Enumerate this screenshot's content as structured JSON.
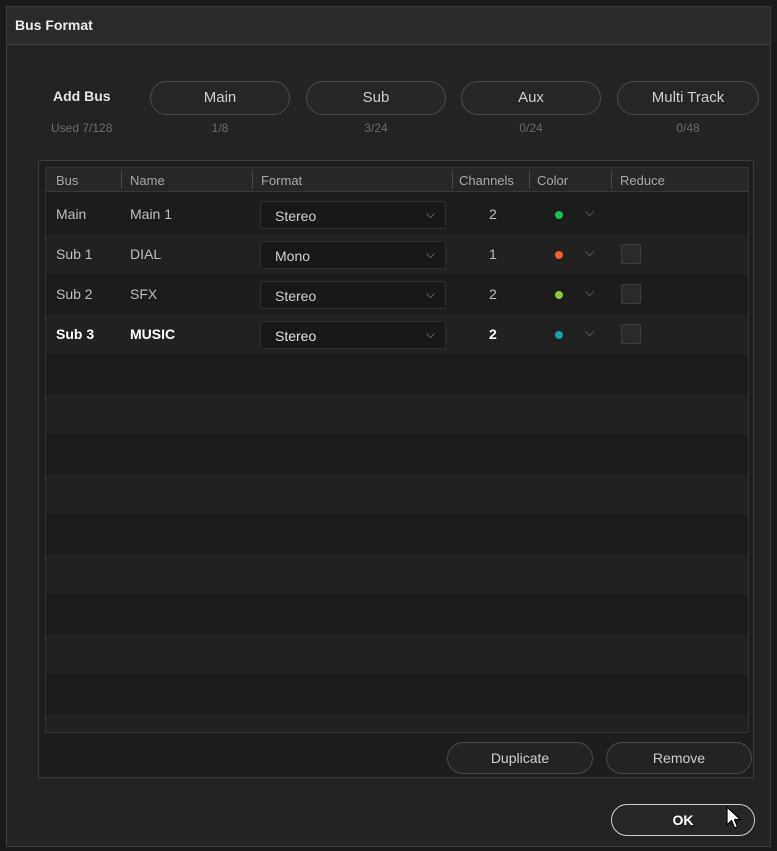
{
  "dialog": {
    "title": "Bus Format"
  },
  "add_bus": {
    "label": "Add Bus",
    "used": "Used 7/128",
    "buttons": [
      {
        "label": "Main",
        "count": "1/8"
      },
      {
        "label": "Sub",
        "count": "3/24"
      },
      {
        "label": "Aux",
        "count": "0/24"
      },
      {
        "label": "Multi Track",
        "count": "0/48"
      }
    ]
  },
  "table": {
    "headers": [
      "Bus",
      "Name",
      "Format",
      "Channels",
      "Color",
      "Reduce"
    ],
    "rows": [
      {
        "bus": "Main",
        "name": "Main 1",
        "format": "Stereo",
        "channels": "2",
        "color": "#1fbf5a",
        "reduce": null
      },
      {
        "bus": "Sub 1",
        "name": "DIAL",
        "format": "Mono",
        "channels": "1",
        "color": "#f0602a",
        "reduce": false
      },
      {
        "bus": "Sub 2",
        "name": "SFX",
        "format": "Stereo",
        "channels": "2",
        "color": "#8dc63f",
        "reduce": false
      },
      {
        "bus": "Sub 3",
        "name": "MUSIC",
        "format": "Stereo",
        "channels": "2",
        "color": "#13a4a8",
        "reduce": false
      }
    ]
  },
  "footer": {
    "duplicate": "Duplicate",
    "remove": "Remove"
  },
  "ok": "OK",
  "icons": {
    "dropdown": "chevron-down-icon",
    "cursor": "mouse-pointer-icon"
  }
}
